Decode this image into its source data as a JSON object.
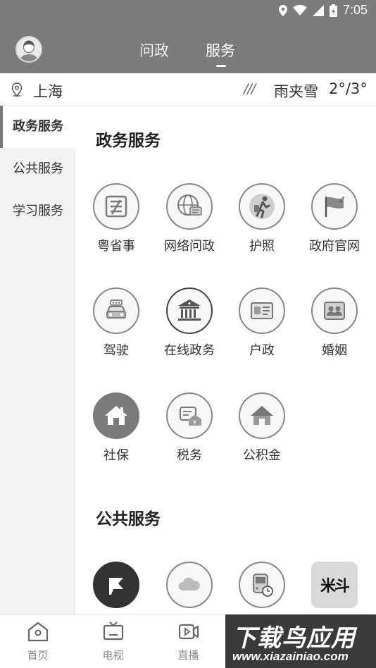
{
  "status_bar": {
    "time": "7:05"
  },
  "header": {
    "tabs": [
      {
        "label": "问政"
      },
      {
        "label": "服务"
      }
    ],
    "active_tab": "服务"
  },
  "location": {
    "city": "上海",
    "weather_icon": "///",
    "weather": "雨夹雪",
    "temp": "2°/3°"
  },
  "sidebar": {
    "items": [
      {
        "label": "政务服务",
        "active": true
      },
      {
        "label": "公共服务"
      },
      {
        "label": "学习服务"
      }
    ]
  },
  "sections": [
    {
      "title": "政务服务",
      "items": [
        {
          "label": "粤省事",
          "icon": "yueshengshi-icon"
        },
        {
          "label": "网络问政",
          "icon": "globe-chat-icon"
        },
        {
          "label": "护照",
          "icon": "traveler-icon"
        },
        {
          "label": "政府官网",
          "icon": "flag-icon"
        },
        {
          "label": "驾驶",
          "icon": "car-icon"
        },
        {
          "label": "在线政务",
          "icon": "government-building-icon"
        },
        {
          "label": "户政",
          "icon": "id-card-icon"
        },
        {
          "label": "婚姻",
          "icon": "couple-icon"
        },
        {
          "label": "社保",
          "icon": "home-icon"
        },
        {
          "label": "税务",
          "icon": "tax-icon"
        },
        {
          "label": "公积金",
          "icon": "house-fund-icon"
        }
      ]
    },
    {
      "title": "公共服务",
      "items": [
        {
          "label": "",
          "icon": "flag-app-icon"
        },
        {
          "label": "",
          "icon": "cloud-icon"
        },
        {
          "label": "",
          "icon": "bus-clock-icon"
        },
        {
          "label": "米斗",
          "icon": "mido-logo-icon"
        }
      ]
    }
  ],
  "bottom_nav": [
    {
      "label": "首页",
      "icon": "home-outline-icon"
    },
    {
      "label": "电视",
      "icon": "tv-icon"
    },
    {
      "label": "直播",
      "icon": "live-icon"
    }
  ],
  "watermark": {
    "line1": "下载鸟应用",
    "line2": "www.xiazainiao.com"
  }
}
